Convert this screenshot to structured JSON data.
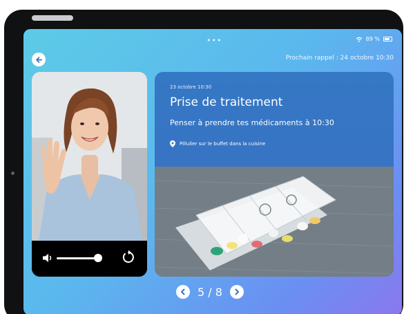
{
  "status_bar": {
    "wifi_icon": "wifi-icon",
    "battery_text": "89 %",
    "battery_icon": "battery-icon"
  },
  "header": {
    "back_icon": "arrow-left-icon",
    "next_reminder": "Prochain rappel : 24 octobre 10:30"
  },
  "video": {
    "volume_icon": "speaker-icon",
    "volume_level": 0.9,
    "replay_icon": "replay-icon"
  },
  "reminder": {
    "datetime": "23 octobre  10:30",
    "title": "Prise de traitement",
    "message": "Penser à prendre tes médicaments à 10:30",
    "location_icon": "location-pin-icon",
    "location": "Pillulier sur le buffet dans la cuisine"
  },
  "pager": {
    "prev_icon": "chevron-left-icon",
    "next_icon": "chevron-right-icon",
    "current": "5",
    "total": "8",
    "label": "5 / 8"
  },
  "colors": {
    "accent": "#3a72c4",
    "bg_start": "#5ccbe6",
    "bg_end": "#8a78ee"
  }
}
